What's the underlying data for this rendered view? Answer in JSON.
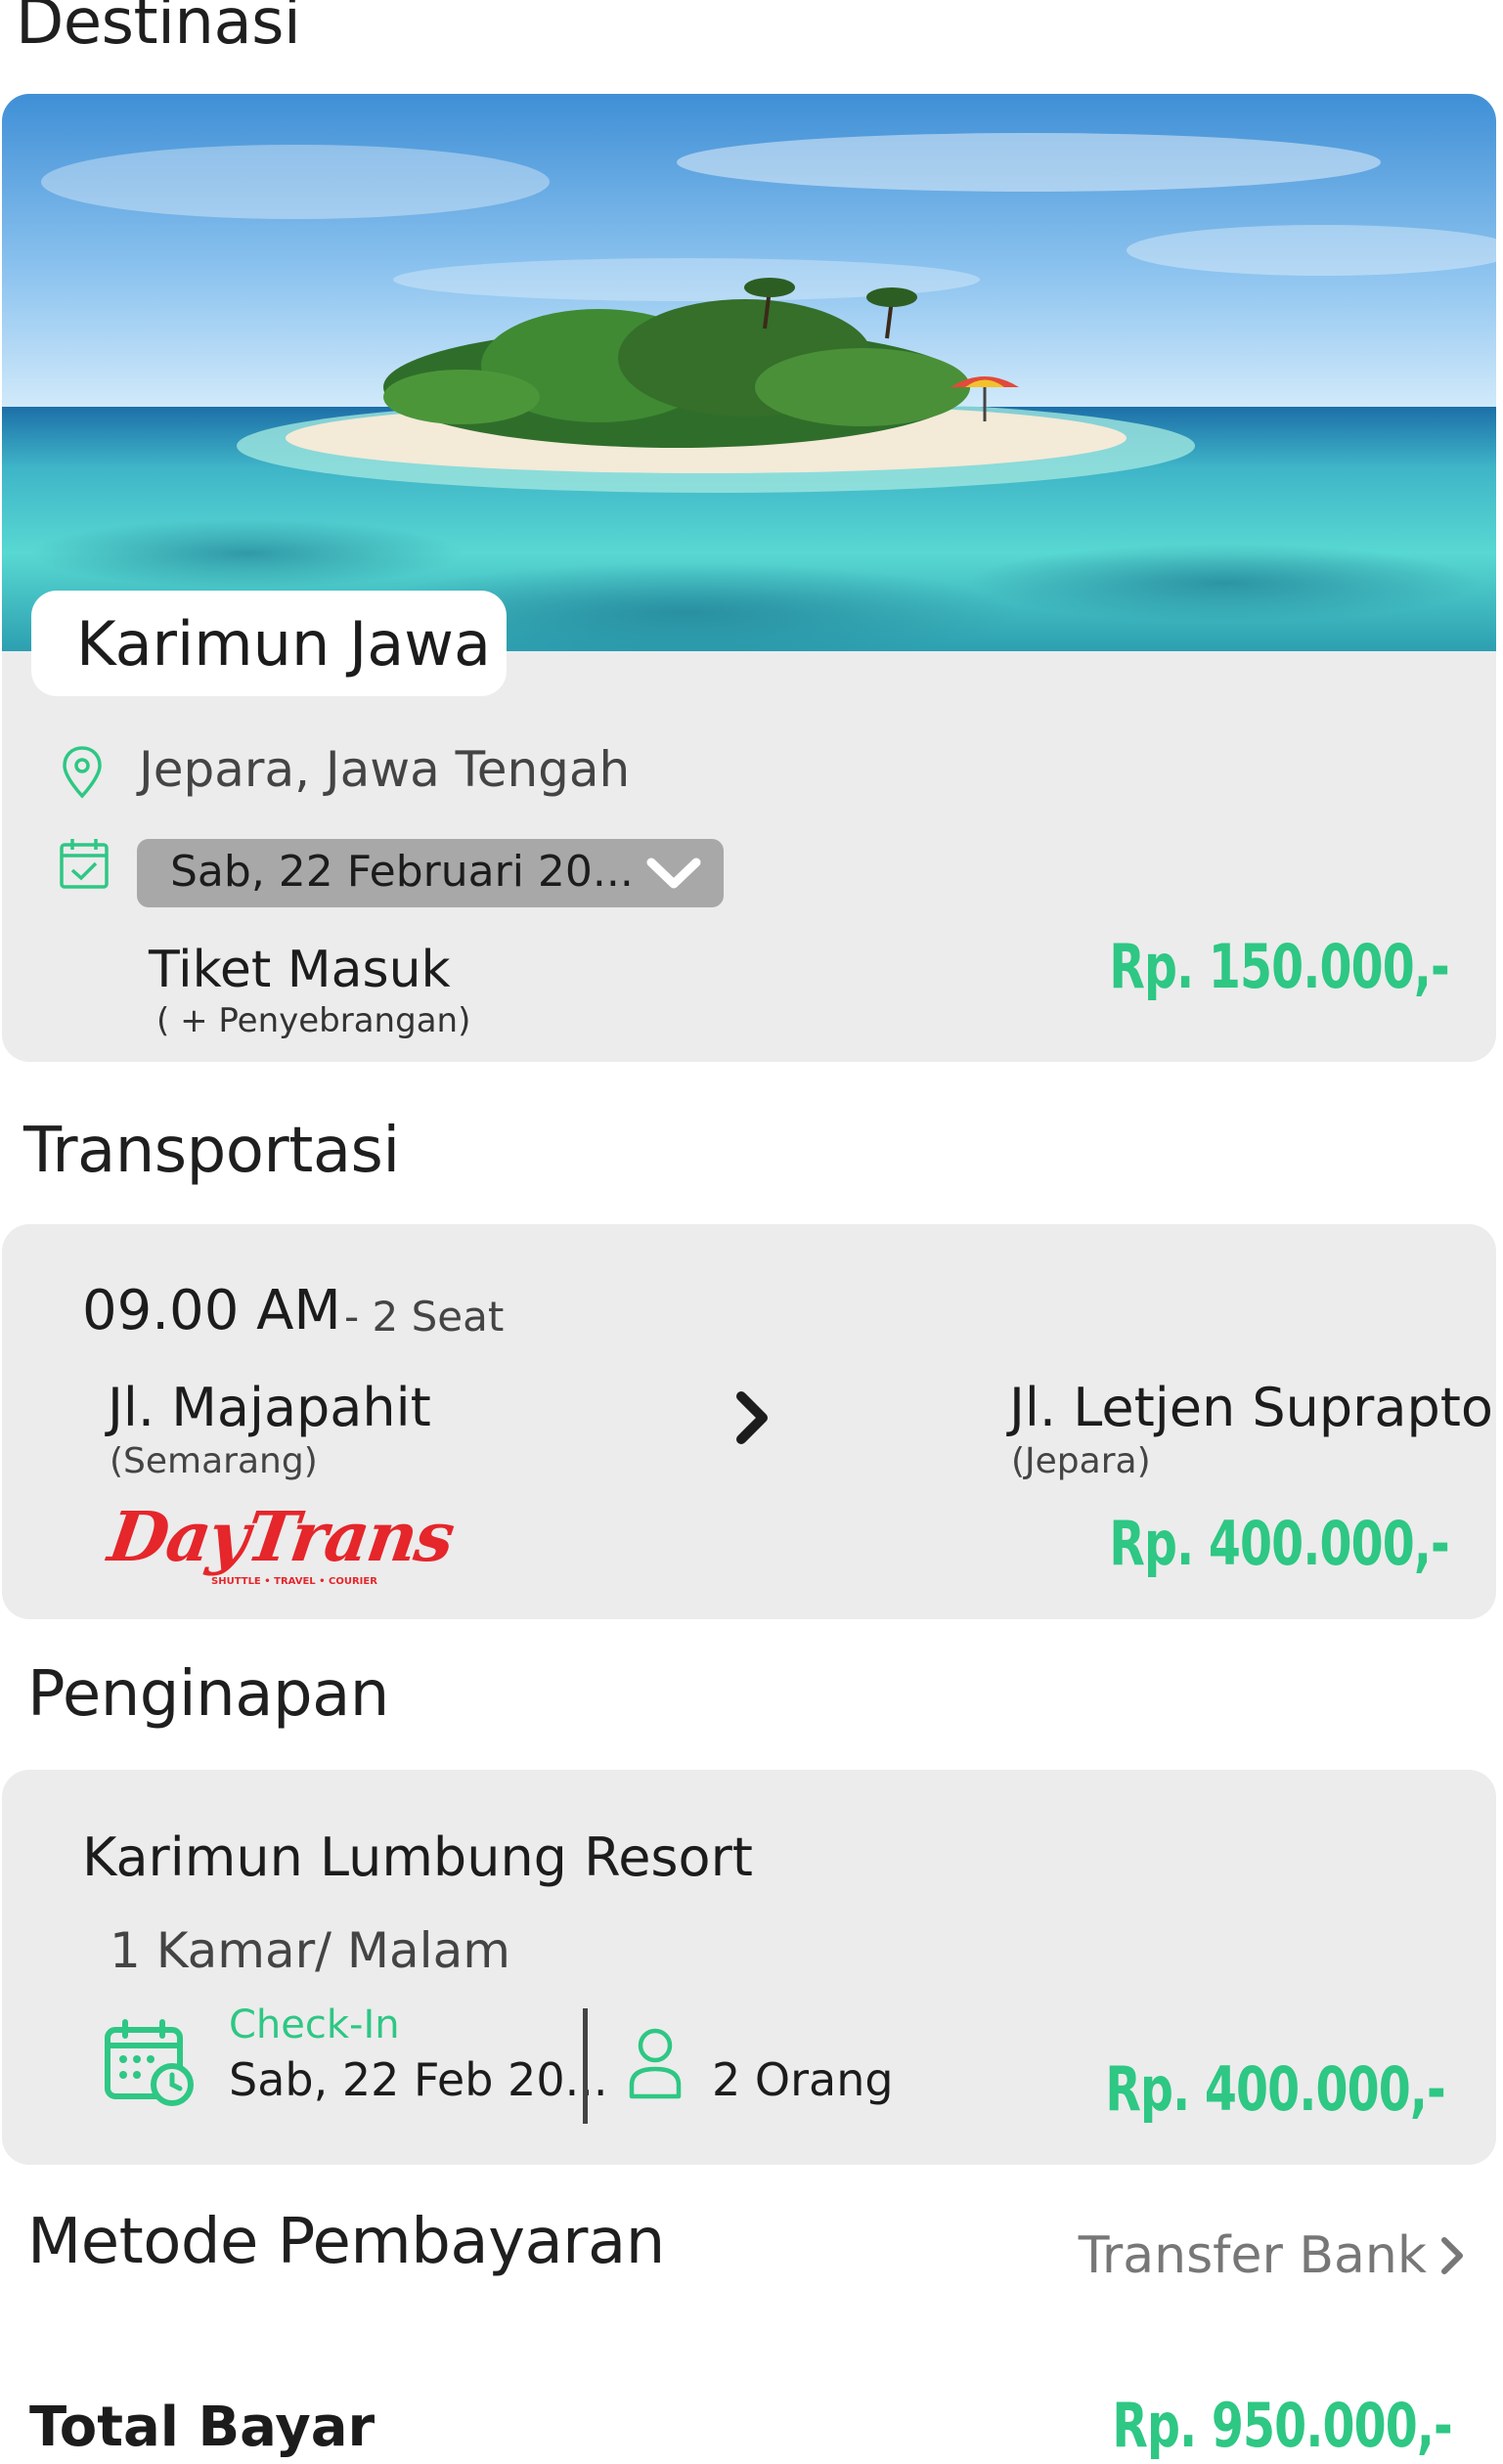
{
  "colors": {
    "accent": "#2ec784",
    "card": "#ececec",
    "brand_red": "#e5262b"
  },
  "destinasi": {
    "section_title": "Destinasi",
    "place_name": "Karimun Jawa",
    "location": "Jepara, Jawa Tengah",
    "date_select": "Sab, 22 Februari 20...",
    "ticket_title": "Tiket Masuk",
    "ticket_subtitle": "( + Penyebrangan)",
    "price": "Rp.  150.000,-"
  },
  "transportasi": {
    "section_title": "Transportasi",
    "time": "09.00 AM",
    "seat": "- 2 Seat",
    "from_street": "Jl. Majapahit",
    "from_city": "(Semarang)",
    "to_street": "Jl. Letjen Suprapto",
    "to_city": "(Jepara)",
    "brand_logo": "DayTrans",
    "brand_tagline": "SHUTTLE • TRAVEL • COURIER",
    "price": "Rp.  400.000,-"
  },
  "penginapan": {
    "section_title": "Penginapan",
    "hotel_name": "Karimun Lumbung Resort",
    "room_info": "1 Kamar/ Malam",
    "checkin_label": "Check-In",
    "checkin_date": "Sab, 22 Feb 20...",
    "guests": "2 Orang",
    "price": "Rp.  400.000,-"
  },
  "payment": {
    "section_title": "Metode Pembayaran",
    "method": "Transfer Bank"
  },
  "total": {
    "label": "Total Bayar",
    "price": "Rp.  950.000,-"
  },
  "icons": [
    "map-pin-icon",
    "calendar-check-icon",
    "chevron-down-icon",
    "chevron-right-icon",
    "calendar-clock-icon",
    "user-icon"
  ]
}
